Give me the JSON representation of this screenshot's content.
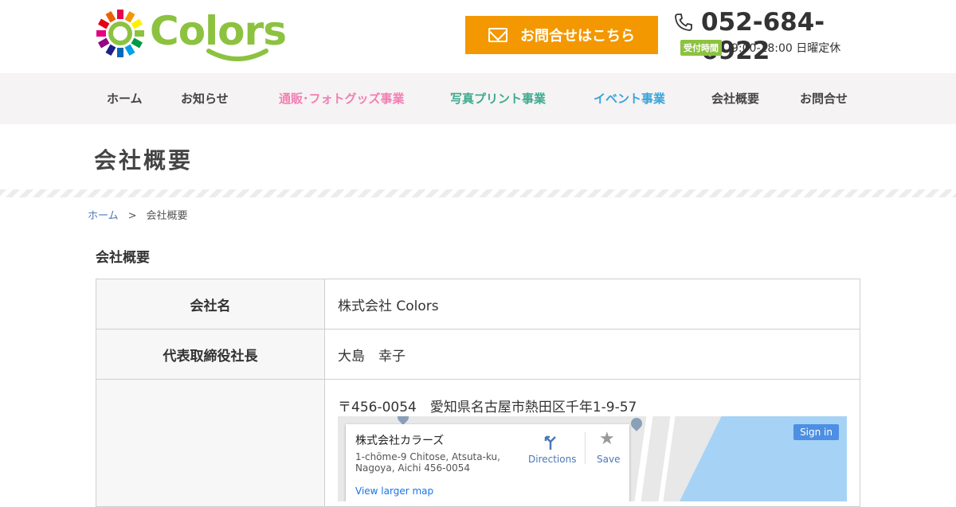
{
  "header": {
    "logo_text": "Colors",
    "contact_label": "お問合せはこちら",
    "tel_number": "052-684-6922",
    "hours_badge": "受付時間",
    "hours_text": "9:00-18:00 日曜定休"
  },
  "nav": {
    "items": [
      {
        "label": "ホーム"
      },
      {
        "label": "お知らせ"
      },
      {
        "label": "通販･フォトグッズ事業"
      },
      {
        "label": "写真プリント事業"
      },
      {
        "label": "イベント事業"
      },
      {
        "label": "会社概要"
      },
      {
        "label": "お問合せ"
      }
    ]
  },
  "page": {
    "title": "会社概要",
    "breadcrumb_home": "ホーム",
    "breadcrumb_sep": ">",
    "breadcrumb_current": "会社概要",
    "section_title": "会社概要"
  },
  "table": {
    "rows": [
      {
        "label": "会社名",
        "value": "株式会社 Colors"
      },
      {
        "label": "代表取締役社長",
        "value": "大島　幸子"
      },
      {
        "label": "",
        "value": "〒456-0054　愛知県名古屋市熱田区千年1-9-57"
      }
    ]
  },
  "map": {
    "place_name": "株式会社カラーズ",
    "place_address": "1-chōme-9 Chitose, Atsuta-ku, Nagoya, Aichi 456-0054",
    "view_larger": "View larger map",
    "directions": "Directions",
    "save": "Save",
    "sign_in": "Sign in"
  },
  "colors": {
    "brand_green": "#8cc23f",
    "contact_orange": "#f39800",
    "nav_pink": "#f27fb3",
    "nav_green": "#3daa8f",
    "nav_blue": "#3aa3d8"
  }
}
